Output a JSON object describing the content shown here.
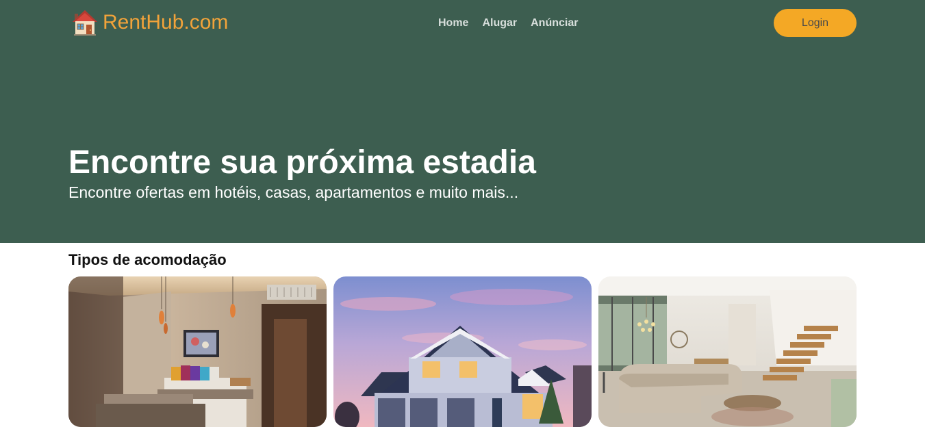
{
  "logo": {
    "text": "RentHub.com",
    "icon": "house-icon"
  },
  "nav": {
    "items": [
      {
        "label": "Home"
      },
      {
        "label": "Alugar"
      },
      {
        "label": "Anúnciar"
      }
    ]
  },
  "login": {
    "label": "Login"
  },
  "hero": {
    "title": "Encontre sua próxima estadia",
    "subtitle": "Encontre ofertas em hotéis, casas, apartamentos e muito mais..."
  },
  "accommodations": {
    "title": "Tipos de acomodação",
    "cards": [
      {
        "image": "hotel-room-photo"
      },
      {
        "image": "house-exterior-photo"
      },
      {
        "image": "apartment-interior-photo"
      }
    ]
  },
  "colors": {
    "hero_bg": "#3d5e50",
    "accent": "#f4a825",
    "logo_text": "#f2a33a"
  }
}
